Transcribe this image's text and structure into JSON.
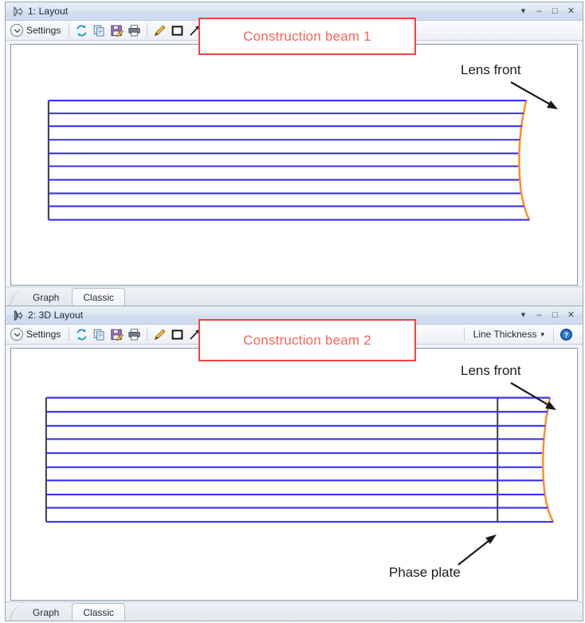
{
  "windows": [
    {
      "id": "layout",
      "title": "1: Layout",
      "icon": "lens-arrow-icon",
      "controls": {
        "dropdown": "▾",
        "minimize": "–",
        "maximize": "□",
        "close": "✕"
      },
      "toolbar": {
        "settings_label": "Settings",
        "chevron": "▾",
        "buttons": [
          {
            "name": "refresh-button",
            "icon": "refresh-icon"
          },
          {
            "name": "copy-button",
            "icon": "copy-icon"
          },
          {
            "name": "save-button",
            "icon": "save-icon"
          },
          {
            "name": "print-button",
            "icon": "print-icon"
          },
          {
            "name": "annotate-pencil-button",
            "icon": "pencil-icon"
          },
          {
            "name": "rectangle-tool-button",
            "icon": "square-icon"
          },
          {
            "name": "arrow-tool-button",
            "icon": "arrow-icon"
          },
          {
            "name": "line-tool-button",
            "icon": "line-icon"
          }
        ],
        "help_label": "",
        "help_icon": "help-icon"
      },
      "tabs": [
        {
          "label": "Graph",
          "selected": false
        },
        {
          "label": "Classic",
          "selected": true
        }
      ],
      "callouts": [
        {
          "name": "lens-front-callout",
          "text": "Lens front"
        }
      ]
    },
    {
      "id": "3dlayout",
      "title": "2: 3D Layout",
      "icon": "lens-3d-icon",
      "controls": {
        "dropdown": "▾",
        "minimize": "–",
        "maximize": "□",
        "close": "✕"
      },
      "toolbar": {
        "settings_label": "Settings",
        "chevron": "▾",
        "buttons": [
          {
            "name": "refresh-button",
            "icon": "refresh-icon"
          },
          {
            "name": "copy-button",
            "icon": "copy-icon"
          },
          {
            "name": "save-button",
            "icon": "save-icon"
          },
          {
            "name": "print-button",
            "icon": "print-icon"
          },
          {
            "name": "annotate-pencil-button",
            "icon": "pencil-icon"
          },
          {
            "name": "rectangle-tool-button",
            "icon": "square-icon"
          },
          {
            "name": "arrow-tool-button",
            "icon": "arrow-icon"
          },
          {
            "name": "line-tool-button",
            "icon": "line-icon"
          }
        ],
        "line_thickness_label": "Line Thickness",
        "line_thickness_chevron": "▾",
        "help_icon": "help-icon"
      },
      "tabs": [
        {
          "label": "Graph",
          "selected": false
        },
        {
          "label": "Classic",
          "selected": true
        }
      ],
      "callouts": [
        {
          "name": "lens-front-callout",
          "text": "Lens front"
        },
        {
          "name": "phase-plate-callout",
          "text": "Phase plate"
        }
      ]
    }
  ],
  "annotations": [
    {
      "name": "construction-beam-1-annotation",
      "text": "Construction beam 1"
    },
    {
      "name": "construction-beam-2-annotation",
      "text": "Construction beam 2"
    }
  ],
  "colors": {
    "ray_blue": "#3a30ee",
    "lens_orange": "#ff8a23",
    "plate_dark": "#3a3a3a",
    "annotation_red": "#fb6359",
    "annotation_border": "#f2453d",
    "callout_black": "#1b1b1b"
  },
  "diagram": {
    "ray_count": 10,
    "description_layout": "collimated ray bundle from left source plane to curved lens front surface",
    "description_3dlayout": "collimated ray bundle crossing a phase plate before reaching the curved lens front surface"
  }
}
